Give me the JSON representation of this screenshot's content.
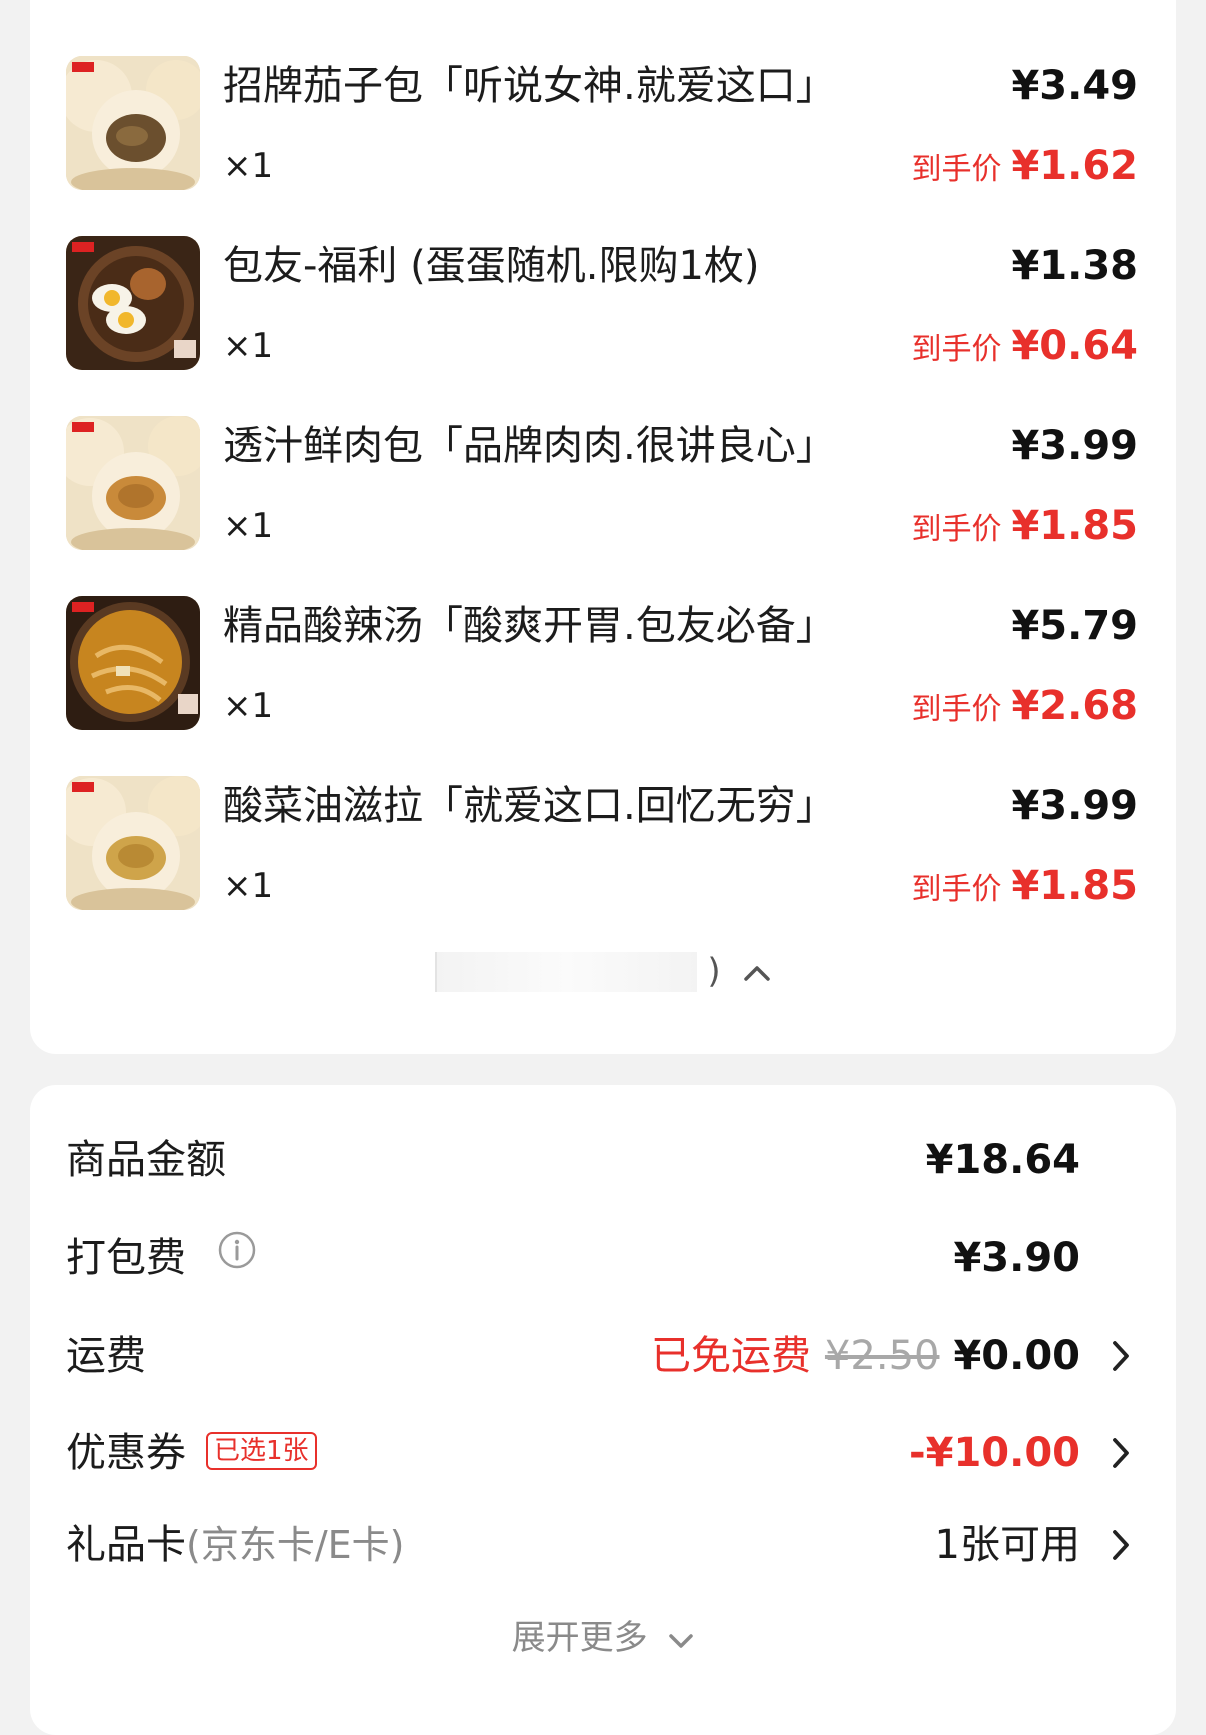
{
  "items": [
    {
      "name": "招牌茄子包「听说女神.就爱这口」",
      "qty": "×1",
      "price": "¥3.49",
      "final_label": "到手价",
      "final_price": "¥1.62",
      "thumb": "bun-eggplant"
    },
    {
      "name": "包友-福利 (蛋蛋随机.限购1枚)",
      "qty": "×1",
      "price": "¥1.38",
      "final_label": "到手价",
      "final_price": "¥0.64",
      "thumb": "egg-bowl"
    },
    {
      "name": "透汁鲜肉包「品牌肉肉.很讲良心」",
      "qty": "×1",
      "price": "¥3.99",
      "final_label": "到手价",
      "final_price": "¥1.85",
      "thumb": "bun-pork"
    },
    {
      "name": "精品酸辣汤「酸爽开胃.包友必备」",
      "qty": "×1",
      "price": "¥5.79",
      "final_label": "到手价",
      "final_price": "¥2.68",
      "thumb": "soup-bowl"
    },
    {
      "name": "酸菜油滋拉「就爱这口.回忆无穷」",
      "qty": "×1",
      "price": "¥3.99",
      "final_label": "到手价",
      "final_price": "¥1.85",
      "thumb": "bun-pickle"
    }
  ],
  "collapse": {
    "paren": ")",
    "icon": "chevron-up-icon"
  },
  "summary": {
    "goods_label": "商品金额",
    "goods_value": "¥18.64",
    "packing_label": "打包费",
    "packing_value": "¥3.90",
    "shipping_label": "运费",
    "shipping_free_text": "已免运费",
    "shipping_original": "¥2.50",
    "shipping_value": "¥0.00",
    "coupon_label": "优惠券",
    "coupon_badge": "已选1张",
    "coupon_value": "-¥10.00",
    "giftcard_label": "礼品卡",
    "giftcard_sub": "(京东卡/E卡)",
    "giftcard_value": "1张可用",
    "expand_label": "展开更多"
  },
  "colors": {
    "accent_red": "#e8302b",
    "background": "#f2f2f2",
    "card": "#ffffff"
  }
}
